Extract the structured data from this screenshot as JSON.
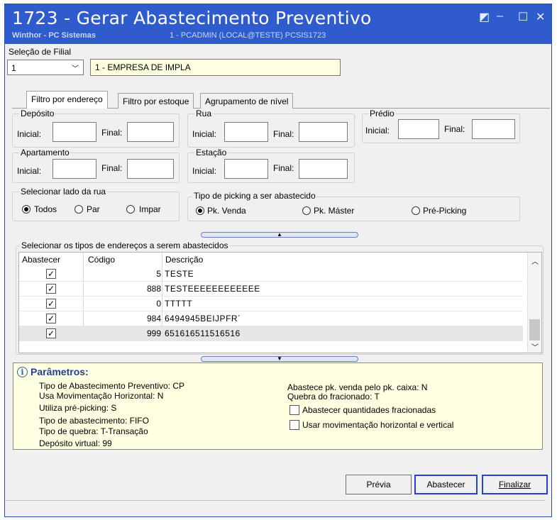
{
  "window": {
    "title": "1723 - Gerar Abastecimento Preventivo",
    "app_name": "Winthor - PC Sistemas",
    "session_info": "1 - PCADMIN (LOCAL@TESTE)   PCSIS1723"
  },
  "filial": {
    "group_label": "Seleção de Filial",
    "code": "1",
    "name": "1 - EMPRESA DE IMPLA"
  },
  "tabs": [
    {
      "label": "Filtro por endereço"
    },
    {
      "label": "Filtro por estoque"
    },
    {
      "label": "Agrupamento de nível"
    }
  ],
  "labels": {
    "inicial": "Inicial:",
    "final": "Final:"
  },
  "ranges": {
    "deposito": "Depósito",
    "rua": "Rua",
    "predio": "Prédio",
    "apartamento": "Apartamento",
    "estacao": "Estação"
  },
  "lado_rua": {
    "title": "Selecionar lado da rua",
    "options": [
      "Todos",
      "Par",
      "Impar"
    ],
    "selected": "Todos"
  },
  "picking": {
    "title": "Tipo de picking a ser abastecido",
    "options": [
      "Pk. Venda",
      "Pk. Máster",
      "Pré-Picking"
    ],
    "selected": "Pk. Venda"
  },
  "enderecos": {
    "title": "Selecionar os tipos de endereços a serem abastecidos",
    "columns": [
      "Abastecer",
      "Código",
      "Descrição"
    ],
    "rows": [
      {
        "checked": true,
        "codigo": "5",
        "descricao": "TESTE"
      },
      {
        "checked": true,
        "codigo": "888",
        "descricao": "TESTEEEEEEEEEEEE"
      },
      {
        "checked": true,
        "codigo": "0",
        "descricao": "TTTTT"
      },
      {
        "checked": true,
        "codigo": "984",
        "descricao": "6494945BEIJPFR´"
      },
      {
        "checked": true,
        "codigo": "999",
        "descricao": "651616511516516"
      }
    ]
  },
  "parametros": {
    "title": "Parâmetros:",
    "left": [
      "Tipo de Abastecimento Preventivo: CP",
      "Usa Movimentação Horizontal: N",
      "Utiliza pré-picking: S",
      "Tipo de abastecimento: FIFO",
      "Tipo de quebra: T-Transação",
      "Depósito virtual: 99"
    ],
    "right": [
      "Abastece pk. venda pelo pk. caixa: N",
      "Quebra do fracionado: T"
    ],
    "checkboxes": [
      {
        "label": "Abastecer quantidades fracionadas",
        "checked": false
      },
      {
        "label": "Usar movimentação horizontal e vertical",
        "checked": false
      }
    ]
  },
  "buttons": {
    "previa": "Prévia",
    "abastecer": "Abastecer",
    "finalizar": "Finalizar"
  }
}
